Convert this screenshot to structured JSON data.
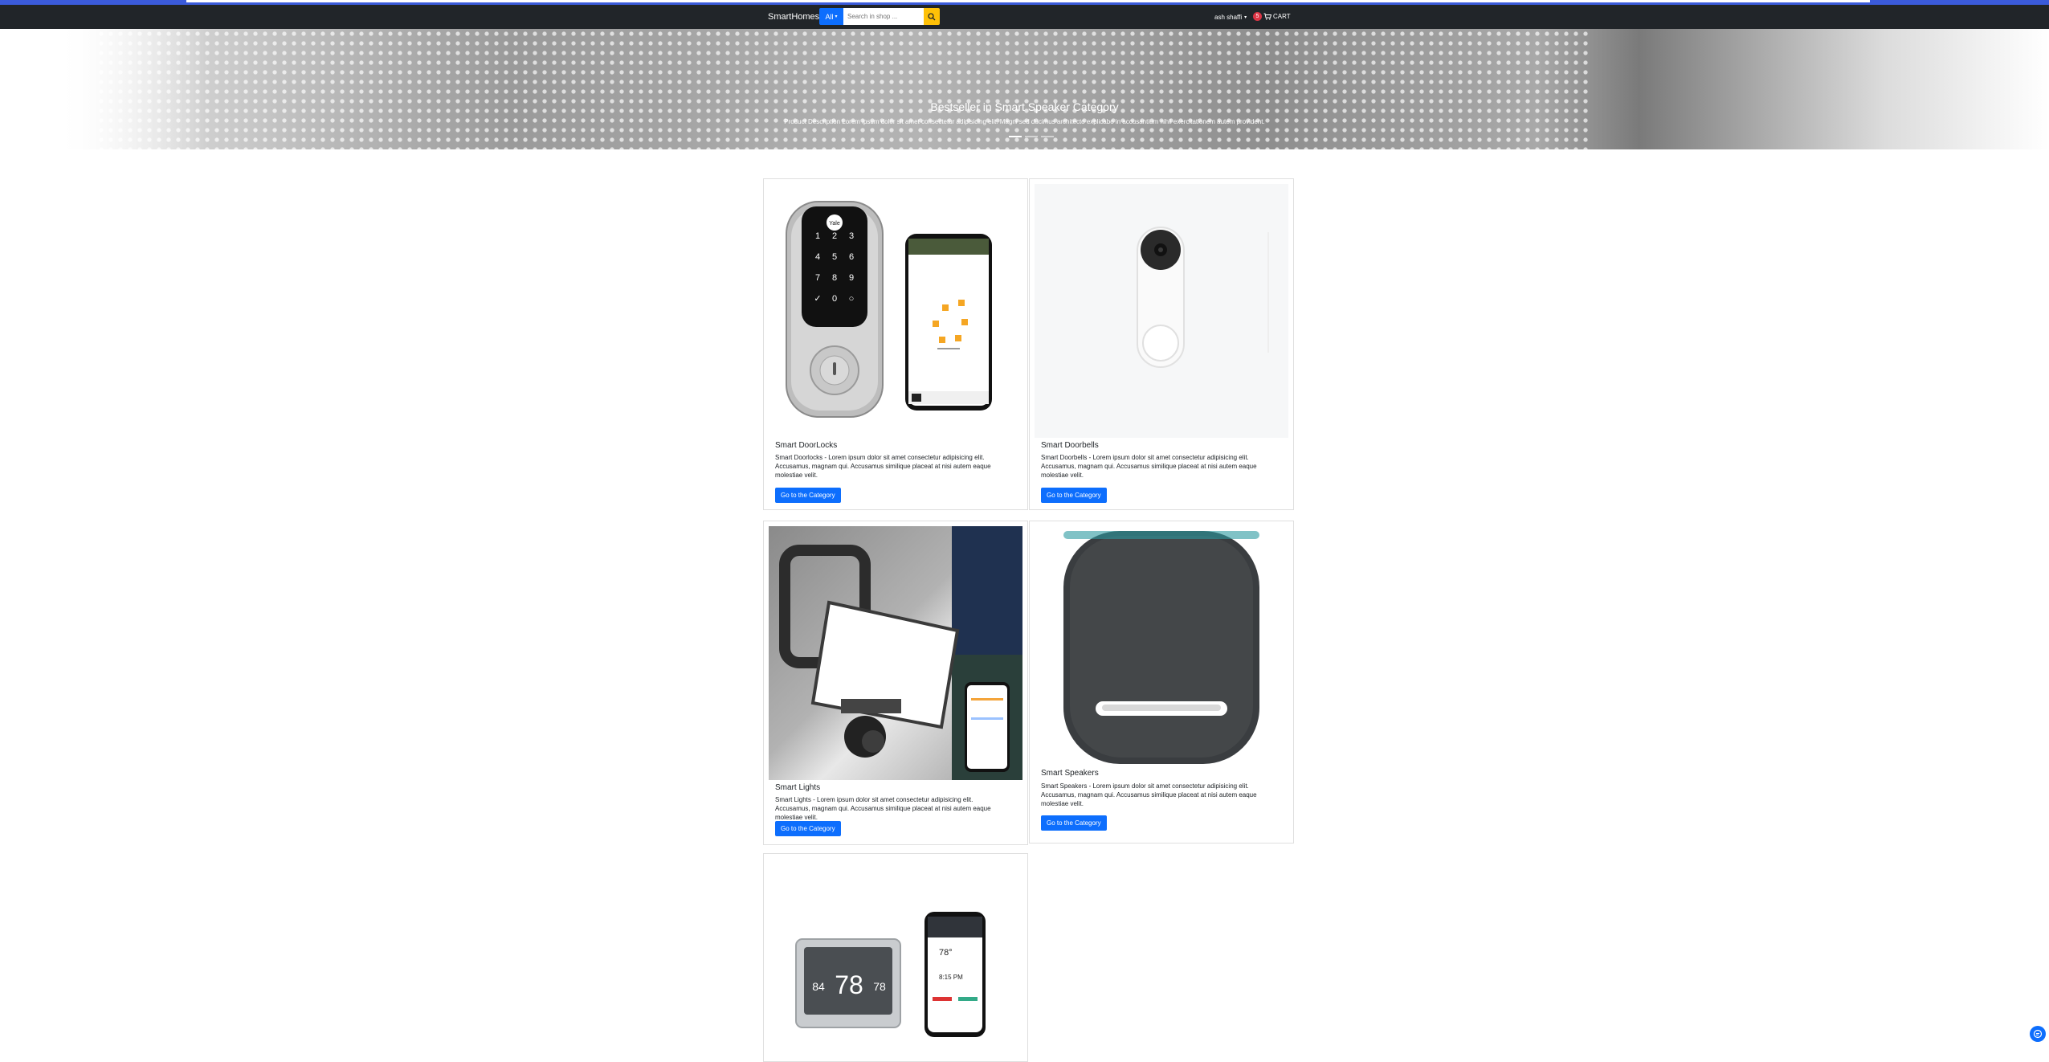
{
  "navbar": {
    "brand": "SmartHomes",
    "search_category": "All",
    "search_placeholder": "Search in shop ...",
    "user_name": "ash shaffi",
    "cart_count": "5",
    "cart_label": "CART"
  },
  "hero": {
    "title": "Bestseller in Smart Speaker Category",
    "description": "Product Description Lorem ipsum dolor sit amet consectetur adipisicing elit. Magni sed ducimus architecto explicabo in accusantium nihil exercitationem autem provident."
  },
  "categories": [
    {
      "title": "Smart DoorLocks",
      "description": "Smart Doorlocks - Lorem ipsum dolor sit amet consectetur adipisicing elit. Accusamus, magnam qui. Accusamus similique placeat at nisi autem eaque molestiae velit.",
      "button": "Go to the Category"
    },
    {
      "title": "Smart Doorbells",
      "description": "Smart Doorbells - Lorem ipsum dolor sit amet consectetur adipisicing elit. Accusamus, magnam qui. Accusamus similique placeat at nisi autem eaque molestiae velit.",
      "button": "Go to the Category"
    },
    {
      "title": "Smart Lights",
      "description": "Smart Lights - Lorem ipsum dolor sit amet consectetur adipisicing elit. Accusamus, magnam qui. Accusamus similique placeat at nisi autem eaque molestiae velit.",
      "button": "Go to the Category"
    },
    {
      "title": "Smart Speakers",
      "description": "Smart Speakers - Lorem ipsum dolor sit amet consectetur adipisicing elit. Accusamus, magnam qui. Accusamus similique placeat at nisi autem eaque molestiae velit.",
      "button": "Go to the Category"
    }
  ],
  "lock_keypad": [
    "1",
    "2",
    "3",
    "4",
    "5",
    "6",
    "7",
    "8",
    "9",
    "✓",
    "0",
    "○"
  ],
  "lock_logo": "Yale",
  "thermostat": {
    "device_values": [
      "84",
      "78",
      "78"
    ],
    "phone_temp": "78°",
    "phone_time": "8:15 PM"
  },
  "colors": {
    "navbar": "#212529",
    "primary": "#0d6efd",
    "search_button": "#ffc107",
    "cart_badge": "#dc3545"
  }
}
